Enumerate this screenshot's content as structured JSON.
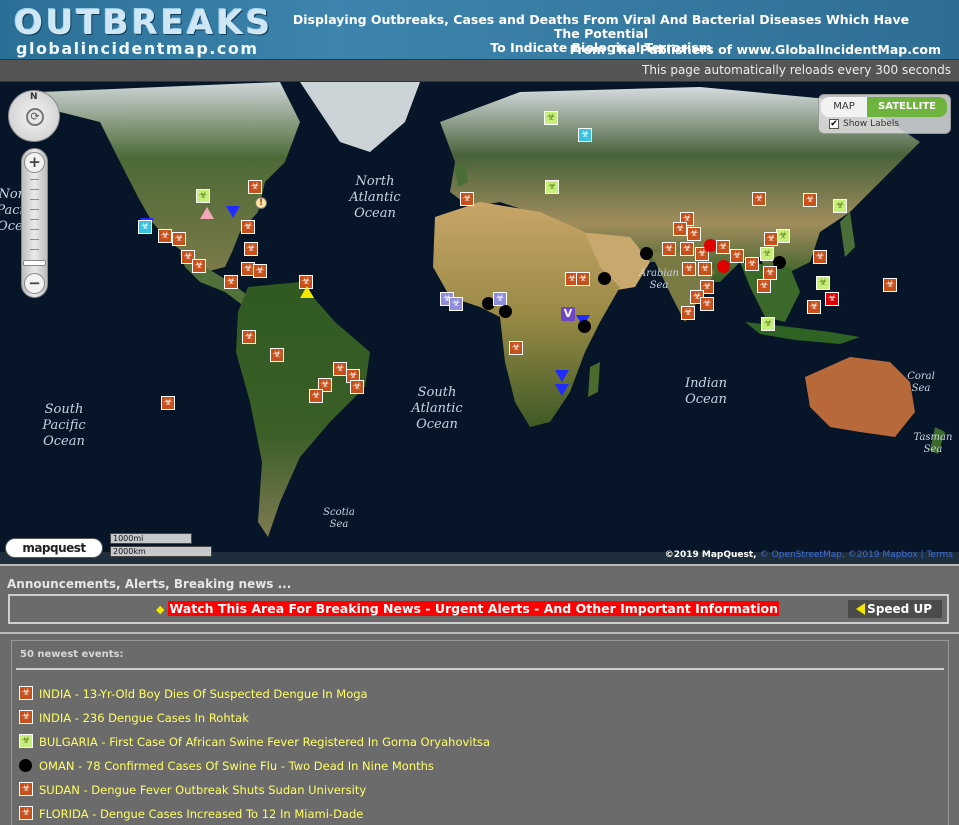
{
  "header": {
    "logo_title": "OUTBREAKS",
    "logo_subtitle": "globalincidentmap.com",
    "description_line1": "Displaying Outbreaks, Cases and Deaths From Viral And Bacterial Diseases Which Have The Potential",
    "description_line2": "To Indicate Biological Terrorism",
    "publisher": "From The Publishers of www.GlobalIncidentMap.com"
  },
  "reload_notice": "This page automatically reloads every 300 seconds",
  "map": {
    "ocean_labels": {
      "north_pacific": "North Pacific Ocean",
      "north_atlantic": "North Atlantic Ocean",
      "arabian_sea": "Arabian Sea",
      "south_pacific": "South Pacific Ocean",
      "south_atlantic": "South Atlantic Ocean",
      "indian": "Indian Ocean",
      "coral_sea": "Coral Sea",
      "tasman_sea": "Tasman Sea",
      "scotia_sea": "Scotia Sea"
    },
    "controls": {
      "pan_north": "N",
      "zoom_in": "+",
      "zoom_out": "−",
      "map_button": "MAP",
      "satellite_button": "SATELLITE",
      "show_labels": "Show Labels",
      "show_labels_checked": true
    },
    "mapquest_logo": "mapquest",
    "scale_miles": "1000mi",
    "scale_km": "2000km",
    "copyright": "©2019 MapQuest,",
    "copyright_links": "© OpenStreetMap, ©2019 Mapbox | Terms",
    "active_map_type": "SATELLITE",
    "accent_color": "#6fb33f"
  },
  "announcements": {
    "title": "Announcements, Alerts, Breaking news ...",
    "ticker": "Watch This Area For Breaking News - Urgent Alerts - And Other Important Information",
    "speed_button": "Speed UP"
  },
  "events": {
    "title": "50 newest events:",
    "items": [
      {
        "icon": "biohazard-icon",
        "text": "INDIA - 13-Yr-Old Boy Dies Of Suspected Dengue In Moga"
      },
      {
        "icon": "biohazard-icon",
        "text": "INDIA - 236 Dengue Cases In Rohtak"
      },
      {
        "icon": "swine-fever-icon",
        "text": "BULGARIA - First Case Of African Swine Fever Registered In Gorna Oryahovitsa"
      },
      {
        "icon": "black-dot-icon",
        "text": "OMAN - 78 Confirmed Cases Of Swine Flu - Two Dead In Nine Months"
      },
      {
        "icon": "biohazard-icon",
        "text": "SUDAN - Dengue Fever Outbreak Shuts Sudan University"
      },
      {
        "icon": "biohazard-icon",
        "text": "FLORIDA - Dengue Cases Increased To 12 In Miami-Dade"
      }
    ]
  }
}
